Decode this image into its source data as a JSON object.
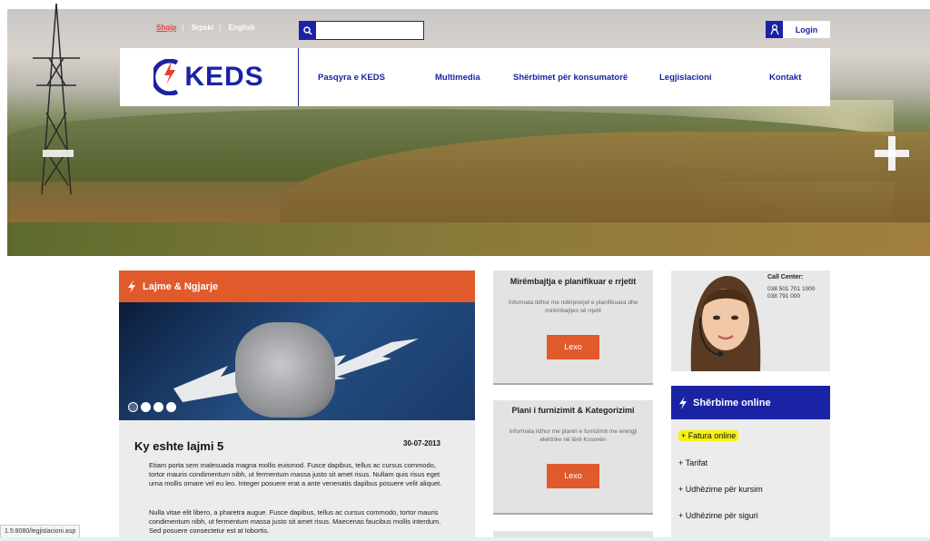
{
  "lang": {
    "items": [
      "Shqip",
      "Srpski",
      "English"
    ],
    "separator": "|"
  },
  "login": {
    "label": "Login"
  },
  "logo": {
    "text": "KEDS"
  },
  "nav": {
    "items": [
      "Pasqyra e KEDS",
      "Multimedia",
      "Shërbimet për konsumatorë",
      "Legjislacioni",
      "Kontakt"
    ]
  },
  "news": {
    "header": "Lajme & Ngjarje",
    "title": "Ky eshte lajmi 5",
    "date": "30-07-2013",
    "p1": "Etiam porta sem malesuada magna mollis euismod. Fusce dapibus, tellus ac cursus commodo, tortor mauris condimentum nibh, ut fermentum massa justo sit amet risus. Nullam quis risus eget urna mollis ornare vel eu leo. Integer posuere erat a ante venenatis dapibus posuere velit aliquet.",
    "p2": "Nulla vitae elit libero, a pharetra augue. Fusce dapibus, tellus ac cursus commodo, tortor mauris condimentum nibh, ut fermentum massa justo sit amet risus. Maecenas faucibus mollis interdum. Sed posuere consectetur est at lobortis."
  },
  "cards": [
    {
      "title": "Mirëmbajtja e planifikuar e rrjetit",
      "desc": "Informata lidhur me ndërprerjet e planifikuara dhe mirëmbajtjes së rrjetit",
      "button": "Lexo"
    },
    {
      "title": "Plani i furnizimit & Kategorizimi",
      "desc": "Informata lidhur me planin e furnizimit me energji elektrike në tërë Kosovën",
      "button": "Lexo"
    }
  ],
  "callcenter": {
    "title": "Call Center:",
    "phone1": "038 501 701 1000",
    "phone2": "038 791 000"
  },
  "online": {
    "header": "Shërbime online",
    "items": [
      "+ Fatura online",
      "+ Tarifat",
      "+ Udhëzime për kursim",
      "+ Udhëzime për siguri"
    ]
  },
  "status": {
    "url": "1.5:8080/legjislacioni.asp"
  },
  "colors": {
    "brand_blue": "#1a23a3",
    "accent_orange": "#e05a2b",
    "highlight": "#f5f012"
  }
}
